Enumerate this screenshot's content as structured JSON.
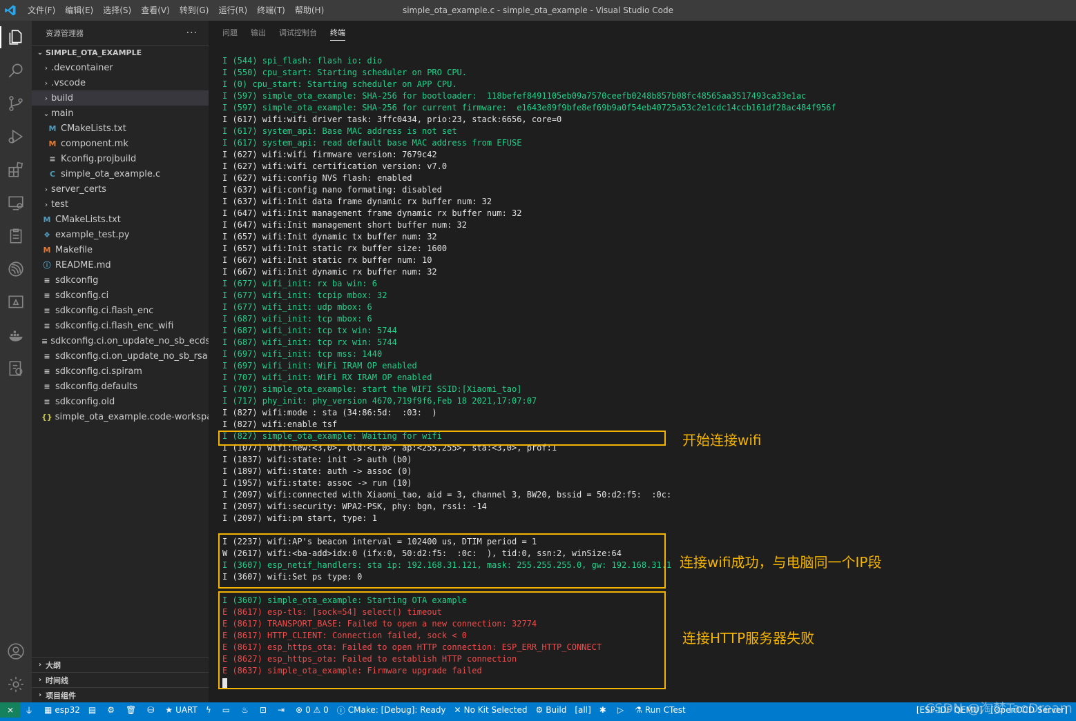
{
  "window": {
    "title": "simple_ota_example.c - simple_ota_example - Visual Studio Code",
    "menu": [
      "文件(F)",
      "编辑(E)",
      "选择(S)",
      "查看(V)",
      "转到(G)",
      "运行(R)",
      "终端(T)",
      "帮助(H)"
    ]
  },
  "colors": {
    "accent": "#007acc",
    "highlight": "#f5b400",
    "log_green": "#23d18b",
    "log_error": "#f14c4c"
  },
  "activitybar": {
    "icons": [
      "explorer-icon",
      "search-icon",
      "source-control-icon",
      "run-debug-icon",
      "extensions-icon",
      "remote-explorer-icon",
      "tasks-icon",
      "espressif-icon",
      "pio-icon",
      "docker-icon",
      "test-icon",
      "account-icon",
      "settings-gear-icon"
    ]
  },
  "sidebar": {
    "title": "资源管理器",
    "more": "···",
    "project": "SIMPLE_OTA_EXAMPLE",
    "tree": [
      {
        "label": ".devcontainer",
        "indent": 1,
        "kind": "folder",
        "icon": ""
      },
      {
        "label": ".vscode",
        "indent": 1,
        "kind": "folder",
        "icon": ""
      },
      {
        "label": "build",
        "indent": 1,
        "kind": "folder",
        "icon": "",
        "selected": true
      },
      {
        "label": "main",
        "indent": 1,
        "kind": "folder-open",
        "icon": ""
      },
      {
        "label": "CMakeLists.txt",
        "indent": 2,
        "kind": "file",
        "icon": "M",
        "iconClass": "icon-m"
      },
      {
        "label": "component.mk",
        "indent": 2,
        "kind": "file",
        "icon": "M",
        "iconClass": "icon-mk"
      },
      {
        "label": "Kconfig.projbuild",
        "indent": 2,
        "kind": "file",
        "icon": "≡",
        "iconClass": "icon-eq"
      },
      {
        "label": "simple_ota_example.c",
        "indent": 2,
        "kind": "file",
        "icon": "C",
        "iconClass": "icon-c"
      },
      {
        "label": "server_certs",
        "indent": 1,
        "kind": "folder",
        "icon": ""
      },
      {
        "label": "test",
        "indent": 1,
        "kind": "folder",
        "icon": ""
      },
      {
        "label": "CMakeLists.txt",
        "indent": 1,
        "kind": "file",
        "icon": "M",
        "iconClass": "icon-m"
      },
      {
        "label": "example_test.py",
        "indent": 1,
        "kind": "file",
        "icon": "❖",
        "iconClass": "icon-py"
      },
      {
        "label": "Makefile",
        "indent": 1,
        "kind": "file",
        "icon": "M",
        "iconClass": "icon-mk"
      },
      {
        "label": "README.md",
        "indent": 1,
        "kind": "file",
        "icon": "ⓘ",
        "iconClass": "icon-info"
      },
      {
        "label": "sdkconfig",
        "indent": 1,
        "kind": "file",
        "icon": "≡",
        "iconClass": "icon-eq"
      },
      {
        "label": "sdkconfig.ci",
        "indent": 1,
        "kind": "file",
        "icon": "≡",
        "iconClass": "icon-eq"
      },
      {
        "label": "sdkconfig.ci.flash_enc",
        "indent": 1,
        "kind": "file",
        "icon": "≡",
        "iconClass": "icon-eq"
      },
      {
        "label": "sdkconfig.ci.flash_enc_wifi",
        "indent": 1,
        "kind": "file",
        "icon": "≡",
        "iconClass": "icon-eq"
      },
      {
        "label": "sdkconfig.ci.on_update_no_sb_ecdsa",
        "indent": 1,
        "kind": "file",
        "icon": "≡",
        "iconClass": "icon-eq"
      },
      {
        "label": "sdkconfig.ci.on_update_no_sb_rsa",
        "indent": 1,
        "kind": "file",
        "icon": "≡",
        "iconClass": "icon-eq"
      },
      {
        "label": "sdkconfig.ci.spiram",
        "indent": 1,
        "kind": "file",
        "icon": "≡",
        "iconClass": "icon-eq"
      },
      {
        "label": "sdkconfig.defaults",
        "indent": 1,
        "kind": "file",
        "icon": "≡",
        "iconClass": "icon-eq"
      },
      {
        "label": "sdkconfig.old",
        "indent": 1,
        "kind": "file",
        "icon": "≡",
        "iconClass": "icon-eq"
      },
      {
        "label": "simple_ota_example.code-workspace",
        "indent": 1,
        "kind": "file",
        "icon": "{}",
        "iconClass": "icon-brace"
      }
    ],
    "bottom_sections": [
      "大纲",
      "时间线",
      "项目组件"
    ]
  },
  "panel": {
    "tabs": [
      "问题",
      "输出",
      "调试控制台",
      "终端"
    ],
    "active_tab": "终端",
    "log": [
      {
        "c": "g",
        "t": "I (544) spi_flash: flash io: dio"
      },
      {
        "c": "g",
        "t": "I (550) cpu_start: Starting scheduler on PRO CPU."
      },
      {
        "c": "g",
        "t": "I (0) cpu_start: Starting scheduler on APP CPU."
      },
      {
        "c": "g",
        "t": "I (597) simple_ota_example: SHA-256 for bootloader:  118befef8491105eb09a7570ceefb0248b857b08fc48565aa3517493ca33e1ac"
      },
      {
        "c": "g",
        "t": "I (597) simple_ota_example: SHA-256 for current firmware:  e1643e89f9bfe8ef69b9a0f54eb40725a53c2e1cdc14ccb161df28ac484f956f"
      },
      {
        "c": "w",
        "t": "I (617) wifi:wifi driver task: 3ffc0434, prio:23, stack:6656, core=0"
      },
      {
        "c": "g",
        "t": "I (617) system_api: Base MAC address is not set"
      },
      {
        "c": "g",
        "t": "I (617) system_api: read default base MAC address from EFUSE"
      },
      {
        "c": "w",
        "t": "I (627) wifi:wifi firmware version: 7679c42"
      },
      {
        "c": "w",
        "t": "I (627) wifi:wifi certification version: v7.0"
      },
      {
        "c": "w",
        "t": "I (627) wifi:config NVS flash: enabled"
      },
      {
        "c": "w",
        "t": "I (637) wifi:config nano formating: disabled"
      },
      {
        "c": "w",
        "t": "I (637) wifi:Init data frame dynamic rx buffer num: 32"
      },
      {
        "c": "w",
        "t": "I (647) wifi:Init management frame dynamic rx buffer num: 32"
      },
      {
        "c": "w",
        "t": "I (647) wifi:Init management short buffer num: 32"
      },
      {
        "c": "w",
        "t": "I (657) wifi:Init dynamic tx buffer num: 32"
      },
      {
        "c": "w",
        "t": "I (657) wifi:Init static rx buffer size: 1600"
      },
      {
        "c": "w",
        "t": "I (667) wifi:Init static rx buffer num: 10"
      },
      {
        "c": "w",
        "t": "I (667) wifi:Init dynamic rx buffer num: 32"
      },
      {
        "c": "g",
        "t": "I (677) wifi_init: rx ba win: 6"
      },
      {
        "c": "g",
        "t": "I (677) wifi_init: tcpip mbox: 32"
      },
      {
        "c": "g",
        "t": "I (677) wifi_init: udp mbox: 6"
      },
      {
        "c": "g",
        "t": "I (687) wifi_init: tcp mbox: 6"
      },
      {
        "c": "g",
        "t": "I (687) wifi_init: tcp tx win: 5744"
      },
      {
        "c": "g",
        "t": "I (687) wifi_init: tcp rx win: 5744"
      },
      {
        "c": "g",
        "t": "I (697) wifi_init: tcp mss: 1440"
      },
      {
        "c": "g",
        "t": "I (697) wifi_init: WiFi IRAM OP enabled"
      },
      {
        "c": "g",
        "t": "I (707) wifi_init: WiFi RX IRAM OP enabled"
      },
      {
        "c": "g",
        "t": "I (707) simple_ota_example: start the WIFI SSID:[Xiaomi_tao]"
      },
      {
        "c": "g",
        "t": "I (717) phy_init: phy_version 4670,719f9f6,Feb 18 2021,17:07:07"
      },
      {
        "c": "w",
        "t": "I (827) wifi:mode : sta (34:86:5d:  :03:  )"
      },
      {
        "c": "w",
        "t": "I (827) wifi:enable tsf"
      },
      {
        "c": "g",
        "t": "I (827) simple_ota_example: Waiting for wifi"
      },
      {
        "c": "w",
        "t": "I (1077) wifi:new:<3,0>, old:<1,0>, ap:<255,255>, sta:<3,0>, prof:1"
      },
      {
        "c": "w",
        "t": "I (1837) wifi:state: init -> auth (b0)"
      },
      {
        "c": "w",
        "t": "I (1897) wifi:state: auth -> assoc (0)"
      },
      {
        "c": "w",
        "t": "I (1957) wifi:state: assoc -> run (10)"
      },
      {
        "c": "w",
        "t": "I (2097) wifi:connected with Xiaomi_tao, aid = 3, channel 3, BW20, bssid = 50:d2:f5:  :0c:  "
      },
      {
        "c": "w",
        "t": "I (2097) wifi:security: WPA2-PSK, phy: bgn, rssi: -14"
      },
      {
        "c": "w",
        "t": "I (2097) wifi:pm start, type: 1"
      },
      {
        "c": "w",
        "t": ""
      },
      {
        "c": "w",
        "t": "I (2237) wifi:AP's beacon interval = 102400 us, DTIM period = 1"
      },
      {
        "c": "w",
        "t": "W (2617) wifi:<ba-add>idx:0 (ifx:0, 50:d2:f5:  :0c:  ), tid:0, ssn:2, winSize:64"
      },
      {
        "c": "g",
        "t": "I (3607) esp_netif_handlers: sta ip: 192.168.31.121, mask: 255.255.255.0, gw: 192.168.31.1"
      },
      {
        "c": "w",
        "t": "I (3607) wifi:Set ps type: 0"
      },
      {
        "c": "w",
        "t": ""
      },
      {
        "c": "g",
        "t": "I (3607) simple_ota_example: Starting OTA example"
      },
      {
        "c": "e",
        "t": "E (8617) esp-tls: [sock=54] select() timeout"
      },
      {
        "c": "e",
        "t": "E (8617) TRANSPORT_BASE: Failed to open a new connection: 32774"
      },
      {
        "c": "e",
        "t": "E (8617) HTTP_CLIENT: Connection failed, sock < 0"
      },
      {
        "c": "e",
        "t": "E (8617) esp_https_ota: Failed to open HTTP connection: ESP_ERR_HTTP_CONNECT"
      },
      {
        "c": "e",
        "t": "E (8627) esp_https_ota: Failed to establish HTTP connection"
      },
      {
        "c": "e",
        "t": "E (8637) simple_ota_example: Firmware upgrade failed"
      }
    ],
    "annotations": {
      "wifi_start": "开始连接wifi",
      "wifi_ok": "连接wifi成功，与电脑同一个IP段",
      "http_fail": "连接HTTP服务器失败"
    }
  },
  "statusbar": {
    "remote": "⨯",
    "items_left": [
      {
        "icon": "plug-icon",
        "glyph": "⏚",
        "label": ""
      },
      {
        "icon": "chip-icon",
        "glyph": "▦",
        "label": "esp32"
      },
      {
        "icon": "folder-icon",
        "glyph": "▤",
        "label": ""
      },
      {
        "icon": "gear-icon",
        "glyph": "⚙",
        "label": ""
      },
      {
        "icon": "trash-icon",
        "glyph": "🗑",
        "label": ""
      },
      {
        "icon": "database-icon",
        "glyph": "⛁",
        "label": ""
      },
      {
        "icon": "star-icon",
        "glyph": "★",
        "label": "UART"
      },
      {
        "icon": "flash-icon",
        "glyph": "ϟ",
        "label": ""
      },
      {
        "icon": "monitor-icon",
        "glyph": "▭",
        "label": ""
      },
      {
        "icon": "flame-icon",
        "glyph": "♨",
        "label": ""
      },
      {
        "icon": "terminal-icon",
        "glyph": "⊡",
        "label": ""
      },
      {
        "icon": "login-icon",
        "glyph": "⇥",
        "label": ""
      },
      {
        "icon": "problems-icon",
        "glyph": "⊗",
        "label": "0 ⚠ 0"
      },
      {
        "icon": "cmake-icon",
        "glyph": "ⓘ",
        "label": "CMake: [Debug]: Ready"
      },
      {
        "icon": "kit-icon",
        "glyph": "✕",
        "label": "No Kit Selected"
      },
      {
        "icon": "build-gear-icon",
        "glyph": "⚙",
        "label": "Build"
      },
      {
        "icon": "target-icon",
        "glyph": "",
        "label": "[all]"
      },
      {
        "icon": "bug-icon",
        "glyph": "✱",
        "label": ""
      },
      {
        "icon": "play-icon",
        "glyph": "▷",
        "label": ""
      },
      {
        "icon": "flask-icon",
        "glyph": "⚗",
        "label": "Run CTest"
      }
    ],
    "items_right": [
      "[ESP-IDF QEMU]",
      "[OpenOCD Server]"
    ],
    "watermark": "CSDN @淘梦TaoDream"
  }
}
